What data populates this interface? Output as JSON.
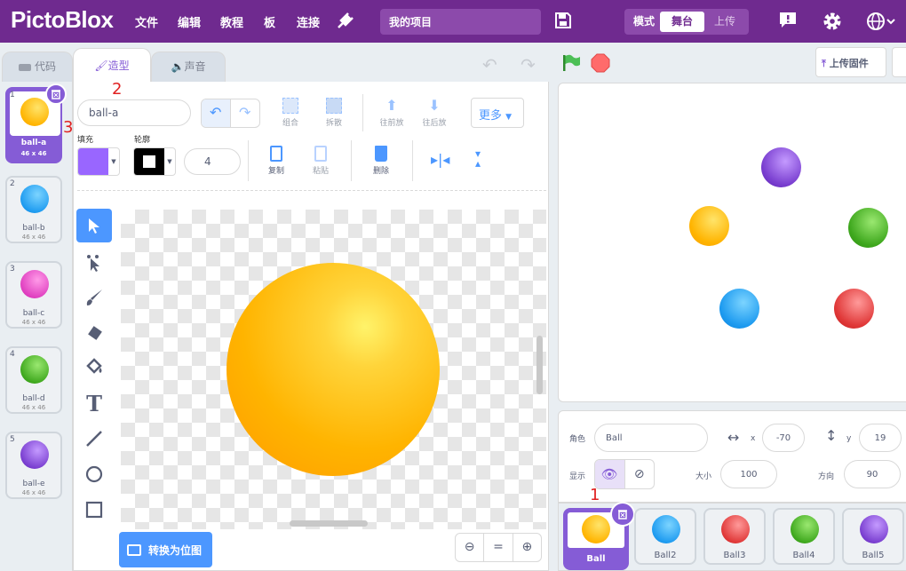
{
  "menubar": {
    "logo": "PictoBlox",
    "items": [
      "文件",
      "编辑",
      "教程",
      "板",
      "连接"
    ],
    "project": "我的项目",
    "mode_label": "模式",
    "mode_stage": "舞台",
    "mode_upload": "上传"
  },
  "tabs": {
    "code": "代码",
    "costume": "造型",
    "sound": "声音"
  },
  "stage_header": {
    "upload_firmware": "上传固件"
  },
  "costumes": [
    {
      "num": "1",
      "name": "ball-a",
      "size": "46 x 46",
      "color": "#ffb400"
    },
    {
      "num": "2",
      "name": "ball-b",
      "size": "46 x 46",
      "color": "#1e9bf0"
    },
    {
      "num": "3",
      "name": "ball-c",
      "size": "46 x 46",
      "color": "#e040c0"
    },
    {
      "num": "4",
      "name": "ball-d",
      "size": "46 x 46",
      "color": "#3fa81e"
    },
    {
      "num": "5",
      "name": "ball-e",
      "size": "46 x 46",
      "color": "#7a3fd0"
    }
  ],
  "editor": {
    "costume_name": "ball-a",
    "group": "组合",
    "ungroup": "拆散",
    "forward": "往前放",
    "backward": "往后放",
    "more": "更多",
    "fill_label": "填充",
    "outline_label": "轮廓",
    "outline_width": "4",
    "copy": "复制",
    "paste": "粘贴",
    "delete": "删除",
    "convert": "转换为位图",
    "zoom_reset": "="
  },
  "sprite_info": {
    "sprite_label": "角色",
    "sprite_name": "Ball",
    "x_label": "x",
    "x": "-70",
    "y_label": "y",
    "y": "19",
    "show_label": "显示",
    "size_label": "大小",
    "size": "100",
    "direction_label": "方向",
    "direction": "90"
  },
  "sprites": [
    {
      "name": "Ball",
      "color": "#ffb400"
    },
    {
      "name": "Ball2",
      "color": "#1e9bf0"
    },
    {
      "name": "Ball3",
      "color": "#e03838"
    },
    {
      "name": "Ball4",
      "color": "#3fa81e"
    },
    {
      "name": "Ball5",
      "color": "#7a3fd0"
    }
  ],
  "annotations": [
    "1",
    "2",
    "3"
  ],
  "colors": {
    "accent": "#6f2a8f",
    "fill_swatch": "#9966ff",
    "orange": "#ffb400"
  }
}
